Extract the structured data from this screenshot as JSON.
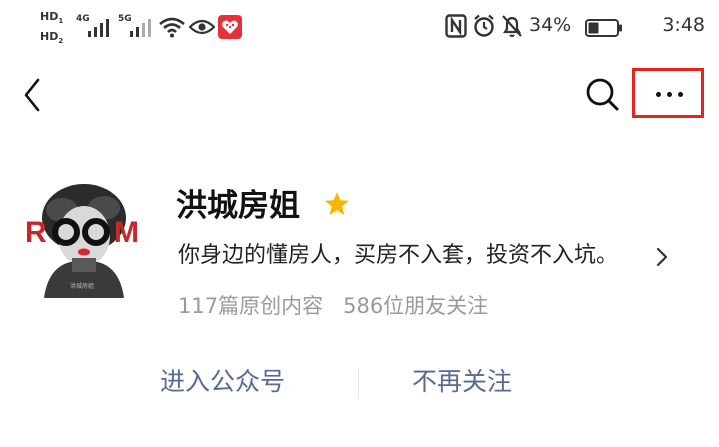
{
  "status_bar": {
    "hd_label": "HD",
    "hd_sub_1": "1",
    "hd_sub_2": "2",
    "signal_1_gen": "4G",
    "signal_2_gen": "5G",
    "battery": "34%",
    "time": "3:48"
  },
  "profile": {
    "name": "洪城房姐",
    "bio": "你身边的懂房人，买房不入套，投资不入坑。",
    "original_count": "117篇原创内容",
    "friends_following": "586位朋友关注"
  },
  "actions": {
    "enter_label": "进入公众号",
    "unfollow_label": "不再关注"
  },
  "colors": {
    "link": "#576b95",
    "highlight_border": "#e8231e",
    "star": "#f7b500",
    "muted_text": "#9a9a9a"
  },
  "icons": {
    "back": "chevron-left-icon",
    "search": "search-icon",
    "more": "more-dots-icon",
    "star": "star-icon",
    "bio_arrow": "chevron-right-icon"
  }
}
